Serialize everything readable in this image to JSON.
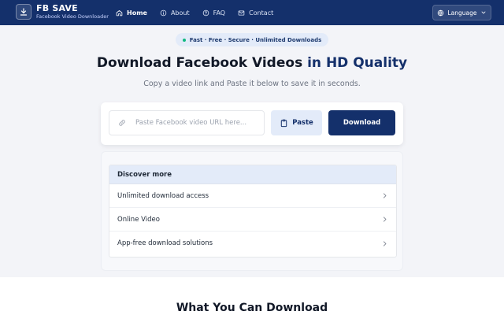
{
  "header": {
    "brand_name": "FB SAVE",
    "brand_tagline": "Facebook Video Downloader",
    "nav": [
      {
        "label": "Home",
        "icon": "home-icon",
        "active": true
      },
      {
        "label": "About",
        "icon": "info-icon"
      },
      {
        "label": "FAQ",
        "icon": "help-icon"
      },
      {
        "label": "Contact",
        "icon": "mail-icon"
      }
    ],
    "language_label": "Language"
  },
  "hero": {
    "pill": "Fast · Free · Secure · Unlimited Downloads",
    "title_main": "Download Facebook Videos ",
    "title_accent": "in HD Quality",
    "subtitle": "Copy a video link and Paste it below to save it in seconds.",
    "url_placeholder": "Paste Facebook video URL here...",
    "url_value": "",
    "paste_label": "Paste",
    "download_label": "Download"
  },
  "discover": {
    "heading": "Discover more",
    "items": [
      "Unlimited download access",
      "Online Video",
      "App-free download solutions"
    ]
  },
  "section": {
    "title": "What You Can Download"
  },
  "colors": {
    "primary": "#14306b",
    "accent_light": "#e3ebf9",
    "status_dot": "#10b981",
    "background": "#f3f4f8"
  }
}
